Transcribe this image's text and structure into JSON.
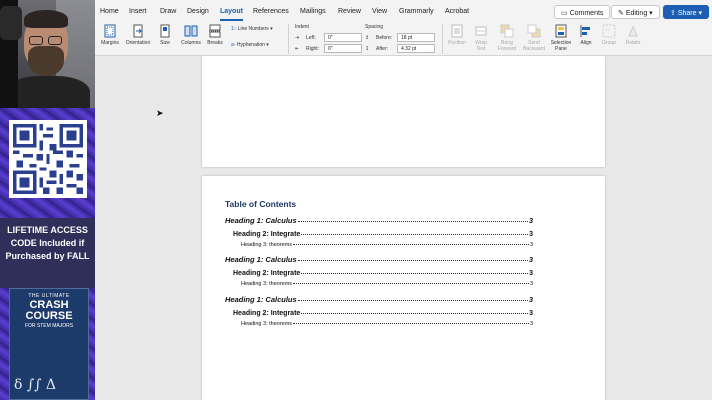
{
  "promo": {
    "access_text_1": "LIFETIME ACCESS",
    "access_text_2": "CODE Included if",
    "access_text_3": "Purchased by FALL",
    "book_line_1": "THE ULTIMATE",
    "book_line_2": "CRASH COURSE",
    "book_line_3": "FOR STEM MAJORS"
  },
  "tabs": [
    "Home",
    "Insert",
    "Draw",
    "Design",
    "Layout",
    "References",
    "Mailings",
    "Review",
    "View",
    "Grammarly",
    "Acrobat"
  ],
  "active_tab": "Layout",
  "top_buttons": {
    "comments": "Comments",
    "editing": "Editing",
    "share": "Share"
  },
  "ribbon": {
    "margins": "Margins",
    "orientation": "Orientation",
    "size": "Size",
    "columns": "Columns",
    "breaks": "Breaks",
    "line_numbers": "Line Numbers",
    "hyphenation": "Hyphenation",
    "indent_label": "Indent",
    "left_label": "Left:",
    "left_value": "0\"",
    "right_label": "Right:",
    "right_value": "0\"",
    "spacing_label": "Spacing",
    "before_label": "Before:",
    "before_value": "18 pt",
    "after_label": "After:",
    "after_value": "4.32 pt",
    "position": "Position",
    "wrap_text": "Wrap Text",
    "bring_forward": "Bring Forward",
    "send_backward": "Send Backward",
    "selection_pane": "Selection Pane",
    "align": "Align",
    "group": "Group",
    "rotate": "Rotate"
  },
  "document": {
    "toc_title": "Table of Contents",
    "entries": [
      {
        "level": 1,
        "text": "Heading 1: Calculus",
        "page": "3"
      },
      {
        "level": 2,
        "text": "Heading 2: Integrate",
        "page": "3"
      },
      {
        "level": 3,
        "text": "Heading 3: theorems",
        "page": "3"
      },
      {
        "level": 1,
        "text": "Heading 1: Calculus",
        "page": "3"
      },
      {
        "level": 2,
        "text": "Heading 2: Integrate",
        "page": "3"
      },
      {
        "level": 3,
        "text": "Heading 3: theorems",
        "page": "3"
      },
      {
        "level": 1,
        "text": "Heading 1: Calculus",
        "page": "3"
      },
      {
        "level": 2,
        "text": "Heading 2: Integrate",
        "page": "3"
      },
      {
        "level": 3,
        "text": "Heading 3: theorems",
        "page": "3"
      }
    ]
  },
  "colors": {
    "accent": "#1d5fb2",
    "toc_title": "#1f3864"
  }
}
